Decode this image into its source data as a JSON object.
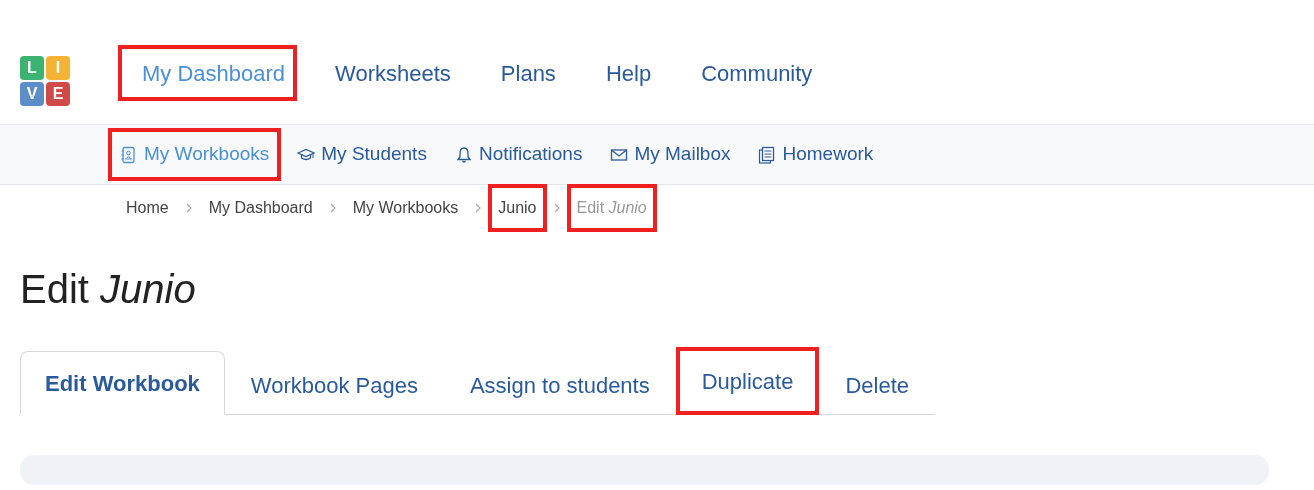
{
  "logo": {
    "letters": [
      {
        "text": "L",
        "color": "#3cb371"
      },
      {
        "text": "I",
        "color": "#f5b335"
      },
      {
        "text": "V",
        "color": "#5b8ec9"
      },
      {
        "text": "E",
        "color": "#d04a4a"
      }
    ]
  },
  "main_nav": [
    {
      "label": "My Dashboard",
      "selected": true,
      "highlighted": true
    },
    {
      "label": "Worksheets",
      "selected": false,
      "highlighted": false
    },
    {
      "label": "Plans",
      "selected": false,
      "highlighted": false
    },
    {
      "label": "Help",
      "selected": false,
      "highlighted": false
    },
    {
      "label": "Community",
      "selected": false,
      "highlighted": false
    }
  ],
  "sub_nav": [
    {
      "label": "My Workbooks",
      "kind": "notebook",
      "selected": true,
      "highlighted": true
    },
    {
      "label": "My Students",
      "kind": "graduation-cap",
      "selected": false,
      "highlighted": false
    },
    {
      "label": "Notifications",
      "kind": "bell",
      "selected": false,
      "highlighted": false
    },
    {
      "label": "My Mailbox",
      "kind": "envelope",
      "selected": false,
      "highlighted": false
    },
    {
      "label": "Homework",
      "kind": "documents",
      "selected": false,
      "highlighted": false
    }
  ],
  "breadcrumb": [
    {
      "label": "Home",
      "current": false,
      "highlighted": false
    },
    {
      "label": "My Dashboard",
      "current": false,
      "highlighted": false
    },
    {
      "label": "My Workbooks",
      "current": false,
      "highlighted": false
    },
    {
      "label": "Junio",
      "current": false,
      "highlighted": true
    },
    {
      "label": "Edit *Junio*",
      "current": true,
      "highlighted": true
    }
  ],
  "page_title": "Edit *Junio*",
  "tabs": [
    {
      "label": "Edit Workbook",
      "selected": true,
      "highlighted": false
    },
    {
      "label": "Workbook Pages",
      "selected": false,
      "highlighted": false
    },
    {
      "label": "Assign to students",
      "selected": false,
      "highlighted": false
    },
    {
      "label": "Duplicate",
      "selected": false,
      "highlighted": true
    },
    {
      "label": "Delete",
      "selected": false,
      "highlighted": false
    }
  ]
}
